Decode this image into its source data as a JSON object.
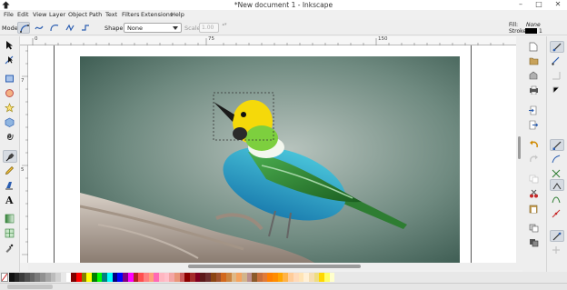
{
  "window": {
    "title": "*New document 1 - Inkscape",
    "minimize": "–",
    "maximize": "□",
    "close": "✕"
  },
  "menu": [
    "File",
    "Edit",
    "View",
    "Layer",
    "Object",
    "Path",
    "Text",
    "Filters",
    "Extensions",
    "Help"
  ],
  "tool_controls": {
    "mode_label": "Mode:",
    "shape_label": "Shape:",
    "shape_value": "None",
    "scale_label": "Scale:",
    "scale_value": "1.00",
    "scale_stepper": "▴▾"
  },
  "style_indicator": {
    "fill_label": "Fill:",
    "fill_value": "None",
    "stroke_label": "Stroke:",
    "stroke_width": "1"
  },
  "ruler": {
    "h_labels": [
      "0",
      "75",
      "150"
    ],
    "v_labels": [
      "7",
      "5"
    ]
  },
  "tools": [
    "selector-icon",
    "node-editor-icon",
    "rectangle-icon",
    "ellipse-icon",
    "star-icon",
    "3d-box-icon",
    "spiral-icon",
    "bezier-pen-icon",
    "pencil-icon",
    "calligraphy-icon",
    "text-icon",
    "gradient-icon",
    "mesh-icon",
    "dropper-icon"
  ],
  "active_tool": "bezier-pen-icon",
  "palette": [
    "#111111",
    "#262626",
    "#3b3b3b",
    "#505050",
    "#666666",
    "#7b7b7b",
    "#919191",
    "#a6a6a6",
    "#bcbcbc",
    "#d2d2d2",
    "#e8e8e8",
    "#ffffff",
    "#800000",
    "#ff0000",
    "#808000",
    "#ffff00",
    "#008000",
    "#00ff00",
    "#008080",
    "#00ffff",
    "#000080",
    "#0000ff",
    "#800080",
    "#ff00ff",
    "#b22222",
    "#ff4f4f",
    "#ff7f7f",
    "#ffa07a",
    "#ff69b4",
    "#ffb6c1",
    "#ffc0cb",
    "#f4a6a6",
    "#e9967a",
    "#cd5c5c",
    "#8b0000",
    "#a52a2a",
    "#800020",
    "#5c1a1a",
    "#6b2e2e",
    "#8b4513",
    "#a0522d",
    "#d2691e",
    "#cd853f",
    "#deb887",
    "#f4a460",
    "#d2b48c",
    "#bc8f8f",
    "#8b5a2b",
    "#c76e3c",
    "#e07b39",
    "#ff7f00",
    "#ff8c00",
    "#ffa500",
    "#ffb347",
    "#ffcc99",
    "#ffdab9",
    "#ffe4b5",
    "#fff0d6",
    "#f5deb3",
    "#eedd82",
    "#ffd700",
    "#ffff66",
    "#ffffcc"
  ]
}
